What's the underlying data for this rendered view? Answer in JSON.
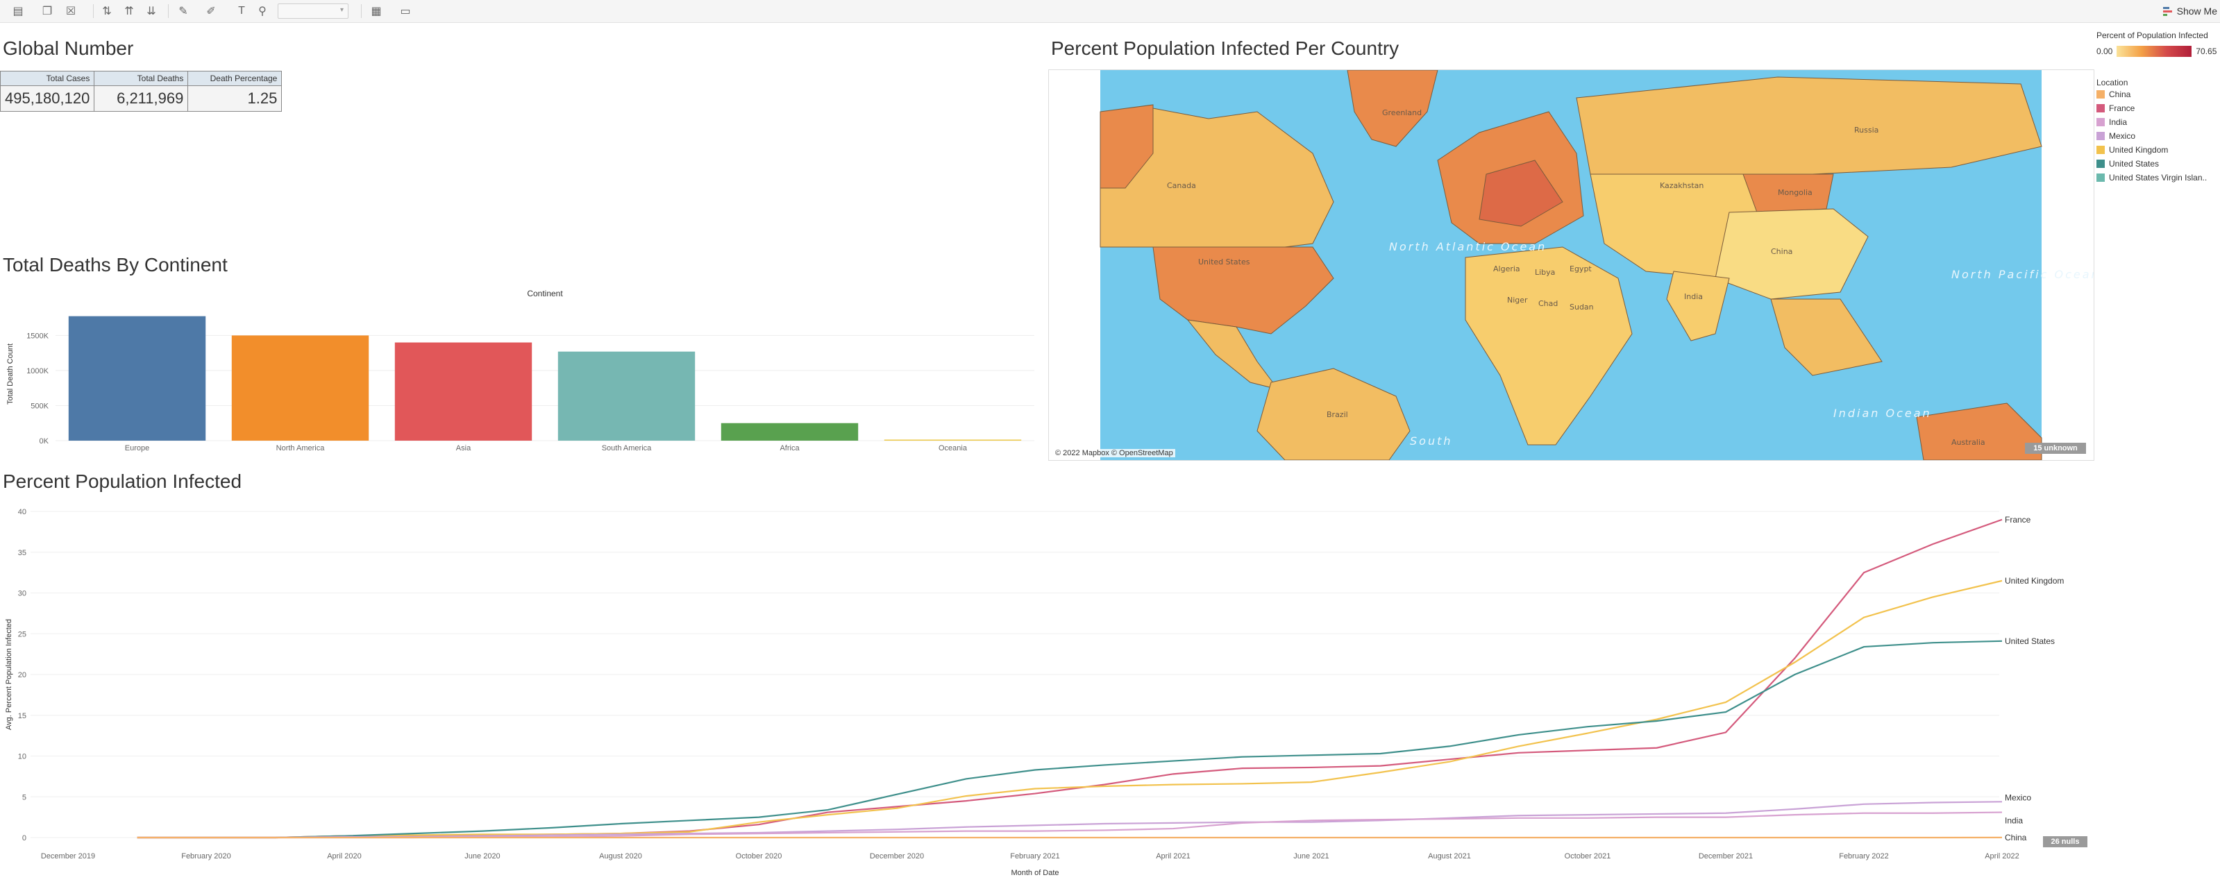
{
  "toolbar": {
    "show_me_label": "Show Me",
    "icons": [
      "new-worksheet-icon",
      "duplicate-icon",
      "clear-icon",
      "swap-icon",
      "sort-ascending-icon",
      "sort-descending-icon",
      "highlight-icon",
      "group-icon",
      "label-icon",
      "pin-icon",
      "fit-icon",
      "presentation-icon"
    ]
  },
  "colors": {
    "China": "#f5b067",
    "France": "#d45a7c",
    "India": "#d7a1d0",
    "Mexico": "#c9a2d6",
    "United Kingdom": "#f2c24d",
    "United States": "#3e8f8b",
    "United States Virgin Islands": "#6bb9ad",
    "ocean": "#73c9ec",
    "land": "#f2bd62",
    "land_hot": "#e98a4b",
    "bar_europe": "#4e79a7",
    "bar_north_america": "#f28e2b",
    "bar_asia": "#e15759",
    "bar_south_america": "#76b7b2",
    "bar_africa": "#59a14f",
    "bar_oceania": "#edc948"
  },
  "global": {
    "title": "Global Number",
    "headers": [
      "Total Cases",
      "Total Deaths",
      "Death Percentage"
    ],
    "values": [
      "495,180,120",
      "6,211,969",
      "1.25"
    ]
  },
  "deaths_title": "Total Deaths By Continent",
  "map": {
    "title": "Percent Population Infected Per Country",
    "attribution": "© 2022 Mapbox © OpenStreetMap",
    "unknown_badge": "15 unknown",
    "labels": [
      "Greenland",
      "Canada",
      "United States",
      "Mongolia",
      "Kazakhstan",
      "Russia",
      "China",
      "India",
      "Algeria",
      "Libya",
      "Egypt",
      "Sudan",
      "Niger",
      "Chad",
      "Brazil",
      "Australia",
      "North Atlantic Ocean",
      "Indian Ocean",
      "North Pacific Ocean",
      "South"
    ]
  },
  "legend": {
    "gradient_title": "Percent of Population Infected",
    "gradient_min": "0.00",
    "gradient_max": "70.65",
    "location_title": "Location",
    "locations": [
      "China",
      "France",
      "India",
      "Mexico",
      "United Kingdom",
      "United States",
      "United States Virgin Islan.."
    ]
  },
  "line_title": "Percent Population Infected",
  "nulls_badge": "26 nulls",
  "chart_data": [
    {
      "type": "bar",
      "title": "Total Deaths By Continent",
      "column_header": "Continent",
      "ylabel": "Total Death Count",
      "categories": [
        "Europe",
        "North America",
        "Asia",
        "South America",
        "Africa",
        "Oceania"
      ],
      "values": [
        1775000,
        1500000,
        1400000,
        1270000,
        250000,
        10000
      ],
      "ylim": [
        0,
        1900000
      ],
      "yticks": [
        0,
        500000,
        1000000,
        1500000
      ],
      "ytick_labels": [
        "0K",
        "500K",
        "1000K",
        "1500K"
      ]
    },
    {
      "type": "line",
      "title": "Percent Population Infected",
      "ylabel": "Avg. Percent Population Infected",
      "xlabel": "Month of Date",
      "ylim": [
        0,
        40
      ],
      "yticks": [
        0,
        5,
        10,
        15,
        20,
        25,
        30,
        35,
        40
      ],
      "xtick_labels": [
        "December 2019",
        "February 2020",
        "April 2020",
        "June 2020",
        "August 2020",
        "October 2020",
        "December 2020",
        "February 2021",
        "April 2021",
        "June 2021",
        "August 2021",
        "October 2021",
        "December 2021",
        "February 2022",
        "April 2022"
      ],
      "x": [
        "Jan 2020",
        "Feb 2020",
        "Mar 2020",
        "Apr 2020",
        "May 2020",
        "Jun 2020",
        "Jul 2020",
        "Aug 2020",
        "Sep 2020",
        "Oct 2020",
        "Nov 2020",
        "Dec 2020",
        "Jan 2021",
        "Feb 2021",
        "Mar 2021",
        "Apr 2021",
        "May 2021",
        "Jun 2021",
        "Jul 2021",
        "Aug 2021",
        "Sep 2021",
        "Oct 2021",
        "Nov 2021",
        "Dec 2021",
        "Jan 2022",
        "Feb 2022",
        "Mar 2022",
        "Apr 2022"
      ],
      "series": [
        {
          "name": "France",
          "values": [
            0,
            0,
            0,
            0.2,
            0.2,
            0.3,
            0.4,
            0.5,
            0.8,
            1.6,
            3.1,
            3.8,
            4.5,
            5.4,
            6.5,
            7.8,
            8.5,
            8.6,
            8.8,
            9.6,
            10.4,
            10.7,
            11.0,
            12.9,
            22.0,
            32.5,
            36.0,
            39.0
          ]
        },
        {
          "name": "United Kingdom",
          "values": [
            0,
            0,
            0,
            0.2,
            0.3,
            0.4,
            0.4,
            0.5,
            0.7,
            1.9,
            2.8,
            3.6,
            5.1,
            6.0,
            6.3,
            6.5,
            6.6,
            6.8,
            8.0,
            9.3,
            11.2,
            12.8,
            14.5,
            16.6,
            21.5,
            27.0,
            29.5,
            31.5
          ]
        },
        {
          "name": "United States",
          "values": [
            0,
            0,
            0,
            0.2,
            0.5,
            0.8,
            1.2,
            1.7,
            2.1,
            2.5,
            3.4,
            5.3,
            7.2,
            8.3,
            8.9,
            9.4,
            9.9,
            10.1,
            10.3,
            11.2,
            12.6,
            13.6,
            14.3,
            15.4,
            20.0,
            23.4,
            23.9,
            24.1
          ]
        },
        {
          "name": "Mexico",
          "values": [
            0,
            0,
            0,
            0.1,
            0.1,
            0.2,
            0.3,
            0.4,
            0.5,
            0.6,
            0.8,
            1.0,
            1.3,
            1.5,
            1.7,
            1.8,
            1.9,
            1.9,
            2.1,
            2.4,
            2.7,
            2.8,
            2.9,
            3.0,
            3.5,
            4.1,
            4.3,
            4.4
          ]
        },
        {
          "name": "India",
          "values": [
            0,
            0,
            0,
            0,
            0,
            0.1,
            0.1,
            0.2,
            0.4,
            0.5,
            0.6,
            0.7,
            0.8,
            0.8,
            0.9,
            1.1,
            1.8,
            2.1,
            2.2,
            2.3,
            2.4,
            2.4,
            2.5,
            2.5,
            2.8,
            3.0,
            3.0,
            3.1
          ]
        },
        {
          "name": "China",
          "values": [
            0,
            0,
            0,
            0,
            0,
            0,
            0,
            0,
            0,
            0,
            0,
            0,
            0,
            0,
            0,
            0,
            0,
            0,
            0,
            0,
            0,
            0,
            0,
            0,
            0,
            0,
            0,
            0.01
          ]
        }
      ]
    }
  ]
}
